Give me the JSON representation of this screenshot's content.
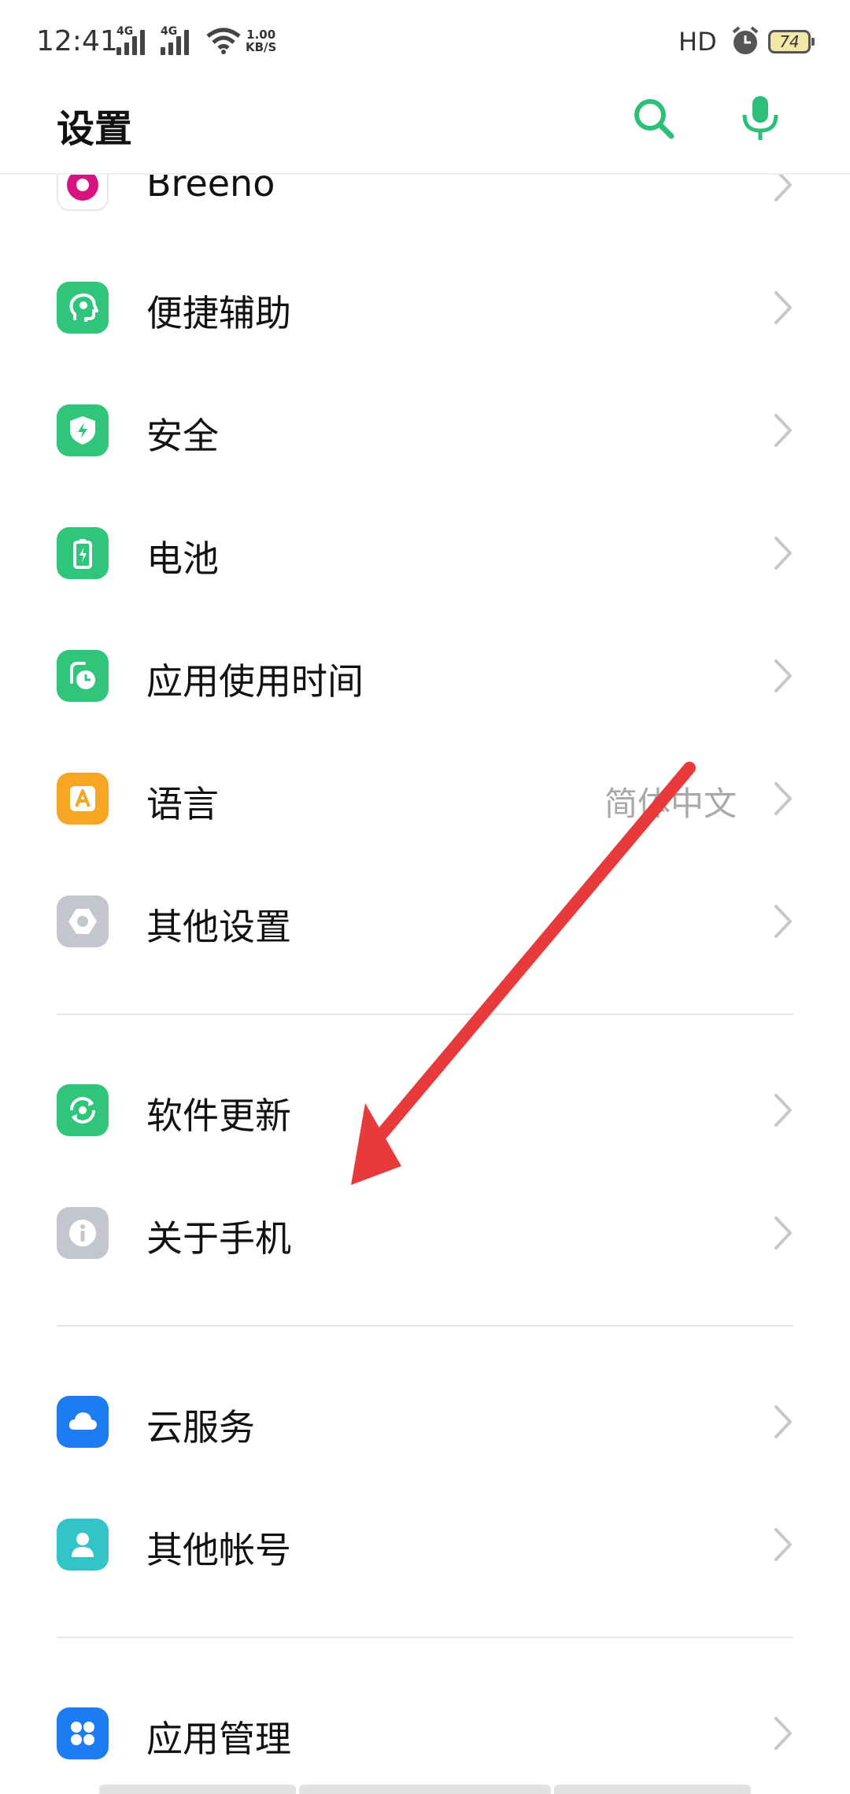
{
  "status_bar": {
    "time": "12:41",
    "signal1_net": "4G",
    "signal2_net": "4G",
    "speed_value": "1.00",
    "speed_unit": "KB/S",
    "hd_label": "HD",
    "battery_level": "74"
  },
  "header": {
    "title": "设置",
    "search_icon": "search-icon",
    "mic_icon": "microphone-icon",
    "accent_color": "#2dbf78"
  },
  "groups": [
    {
      "items": [
        {
          "label": "Breeno",
          "icon": "breeno-icon",
          "icon_color": "#ffffff"
        },
        {
          "label": "便捷辅助",
          "icon": "assist-head-icon",
          "icon_color": "#2fc57a"
        },
        {
          "label": "安全",
          "icon": "shield-bolt-icon",
          "icon_color": "#2fc57a"
        },
        {
          "label": "电池",
          "icon": "battery-bolt-icon",
          "icon_color": "#2fc57a"
        },
        {
          "label": "应用使用时间",
          "icon": "app-timer-icon",
          "icon_color": "#2fc57a"
        },
        {
          "label": "语言",
          "value": "简体中文",
          "icon": "language-a-icon",
          "icon_color": "#f6a623"
        },
        {
          "label": "其他设置",
          "icon": "hexagon-settings-icon",
          "icon_color": "#c3c6cc"
        }
      ]
    },
    {
      "items": [
        {
          "label": "软件更新",
          "icon": "software-update-icon",
          "icon_color": "#2fc57a"
        },
        {
          "label": "关于手机",
          "icon": "info-icon",
          "icon_color": "#c3c6cc"
        }
      ]
    },
    {
      "items": [
        {
          "label": "云服务",
          "icon": "cloud-icon",
          "icon_color": "#1e7cf2"
        },
        {
          "label": "其他帐号",
          "icon": "account-person-icon",
          "icon_color": "#33c4c9"
        }
      ]
    },
    {
      "items": [
        {
          "label": "应用管理",
          "icon": "app-grid-icon",
          "icon_color": "#1e7cf2"
        }
      ]
    }
  ],
  "annotation": {
    "icon": "red-arrow-annotation",
    "color": "#e83a3a"
  }
}
